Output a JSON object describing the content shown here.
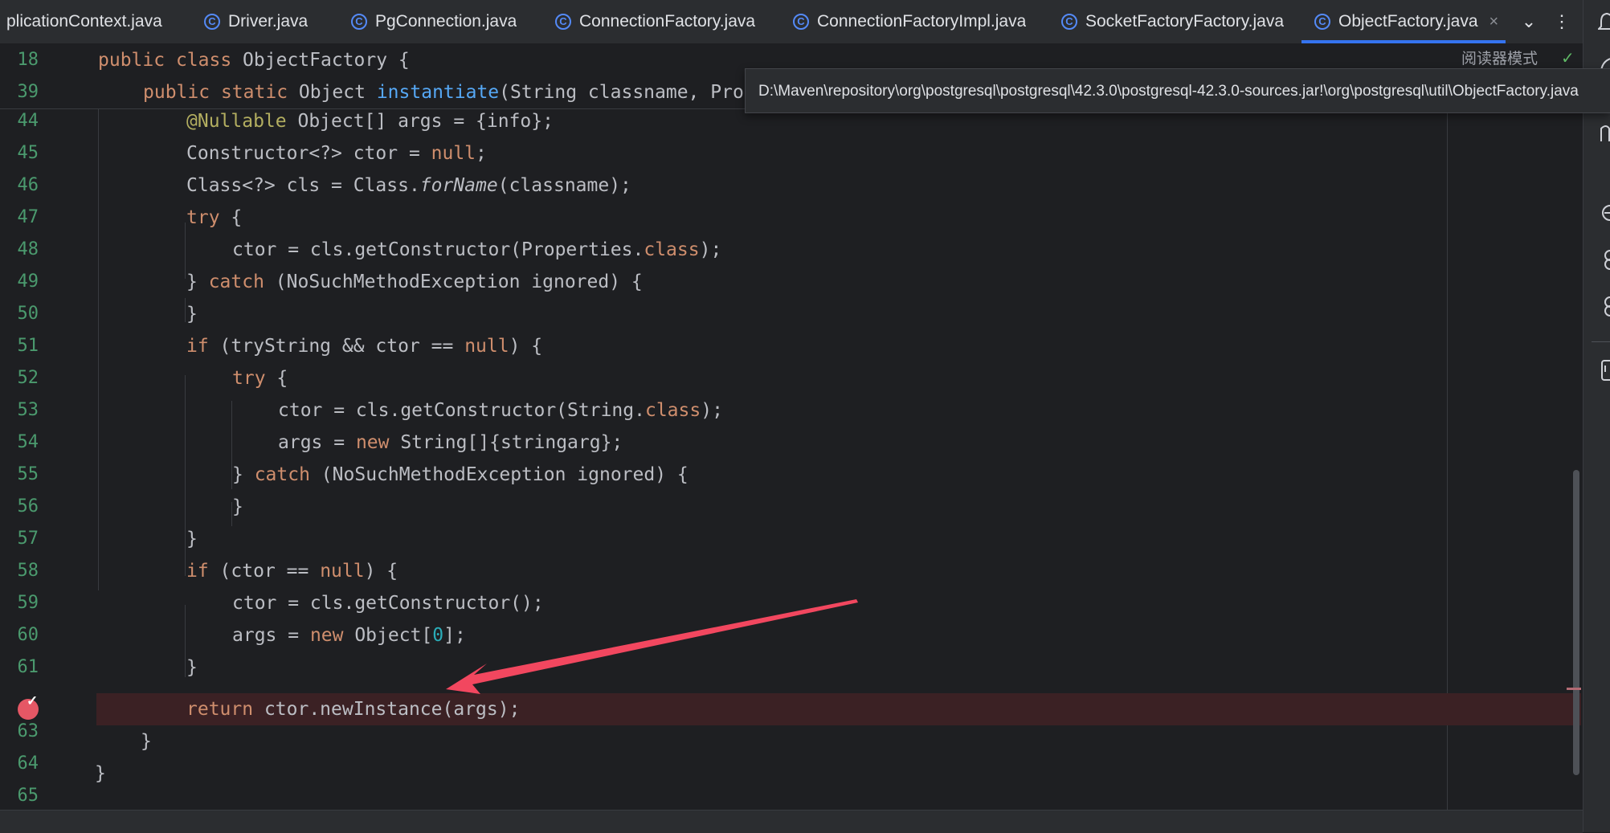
{
  "tabs": [
    {
      "label": "plicationContext.java",
      "icon": "class-icon",
      "active": false
    },
    {
      "label": "Driver.java",
      "icon": "class-icon",
      "active": false
    },
    {
      "label": "PgConnection.java",
      "icon": "class-icon",
      "active": false
    },
    {
      "label": "ConnectionFactory.java",
      "icon": "class-icon",
      "active": false
    },
    {
      "label": "ConnectionFactoryImpl.java",
      "icon": "class-icon",
      "active": false
    },
    {
      "label": "SocketFactoryFactory.java",
      "icon": "class-icon",
      "active": false
    },
    {
      "label": "ObjectFactory.java",
      "icon": "class-icon",
      "active": true
    }
  ],
  "tab_tools": {
    "more_tabs_glyph": "⌄",
    "menu_glyph": "⋮",
    "close_glyph": "×"
  },
  "class_icon_glyph": "C",
  "reader_mode_label": "阅读器模式",
  "reader_check_glyph": "✓",
  "tooltip_path": "D:\\Maven\\repository\\org\\postgresql\\postgresql\\42.3.0\\postgresql-42.3.0-sources.jar!\\org\\postgresql\\util\\ObjectFactory.java",
  "sticky_lines": [
    {
      "num": "18",
      "text": "public class ObjectFactory {"
    },
    {
      "num": "39",
      "text": "public static Object instantiate(String classname, Pro"
    }
  ],
  "code_lines": [
    {
      "num": "44",
      "text": "@Nullable Object[] args = {info};"
    },
    {
      "num": "45",
      "text": "Constructor<?> ctor = null;"
    },
    {
      "num": "46",
      "text": "Class<?> cls = Class.forName(classname);"
    },
    {
      "num": "47",
      "text": "try {"
    },
    {
      "num": "48",
      "text": "ctor = cls.getConstructor(Properties.class);"
    },
    {
      "num": "49",
      "text": "} catch (NoSuchMethodException ignored) {"
    },
    {
      "num": "50",
      "text": "}"
    },
    {
      "num": "51",
      "text": "if (tryString && ctor == null) {"
    },
    {
      "num": "52",
      "text": "try {"
    },
    {
      "num": "53",
      "text": "ctor = cls.getConstructor(String.class);"
    },
    {
      "num": "54",
      "text": "args = new String[]{stringarg};"
    },
    {
      "num": "55",
      "text": "} catch (NoSuchMethodException ignored) {"
    },
    {
      "num": "56",
      "text": "}"
    },
    {
      "num": "57",
      "text": "}"
    },
    {
      "num": "58",
      "text": "if (ctor == null) {"
    },
    {
      "num": "59",
      "text": "ctor = cls.getConstructor();"
    },
    {
      "num": "60",
      "text": "args = new Object[0];"
    },
    {
      "num": "61",
      "text": "}"
    },
    {
      "num": "",
      "text": "return ctor.newInstance(args);",
      "breakpoint": true
    },
    {
      "num": "63",
      "text": "}"
    },
    {
      "num": "64",
      "text": "}"
    },
    {
      "num": "65",
      "text": ""
    }
  ],
  "colors": {
    "keyword": "#cf8e6d",
    "method": "#56a8f5",
    "annotation": "#b3ae60",
    "number": "#2aacb8",
    "line_number": "#4b9a6e",
    "breakpoint": "#e55765",
    "annotation_arrow": "#f2475f"
  },
  "right_strip_icons": [
    "notifications-icon",
    "ai-assistant-icon",
    "database-icon",
    "maven-icon",
    "gradle-icon",
    "spring-icon",
    "endpoints-icon",
    "coverage-icon"
  ]
}
